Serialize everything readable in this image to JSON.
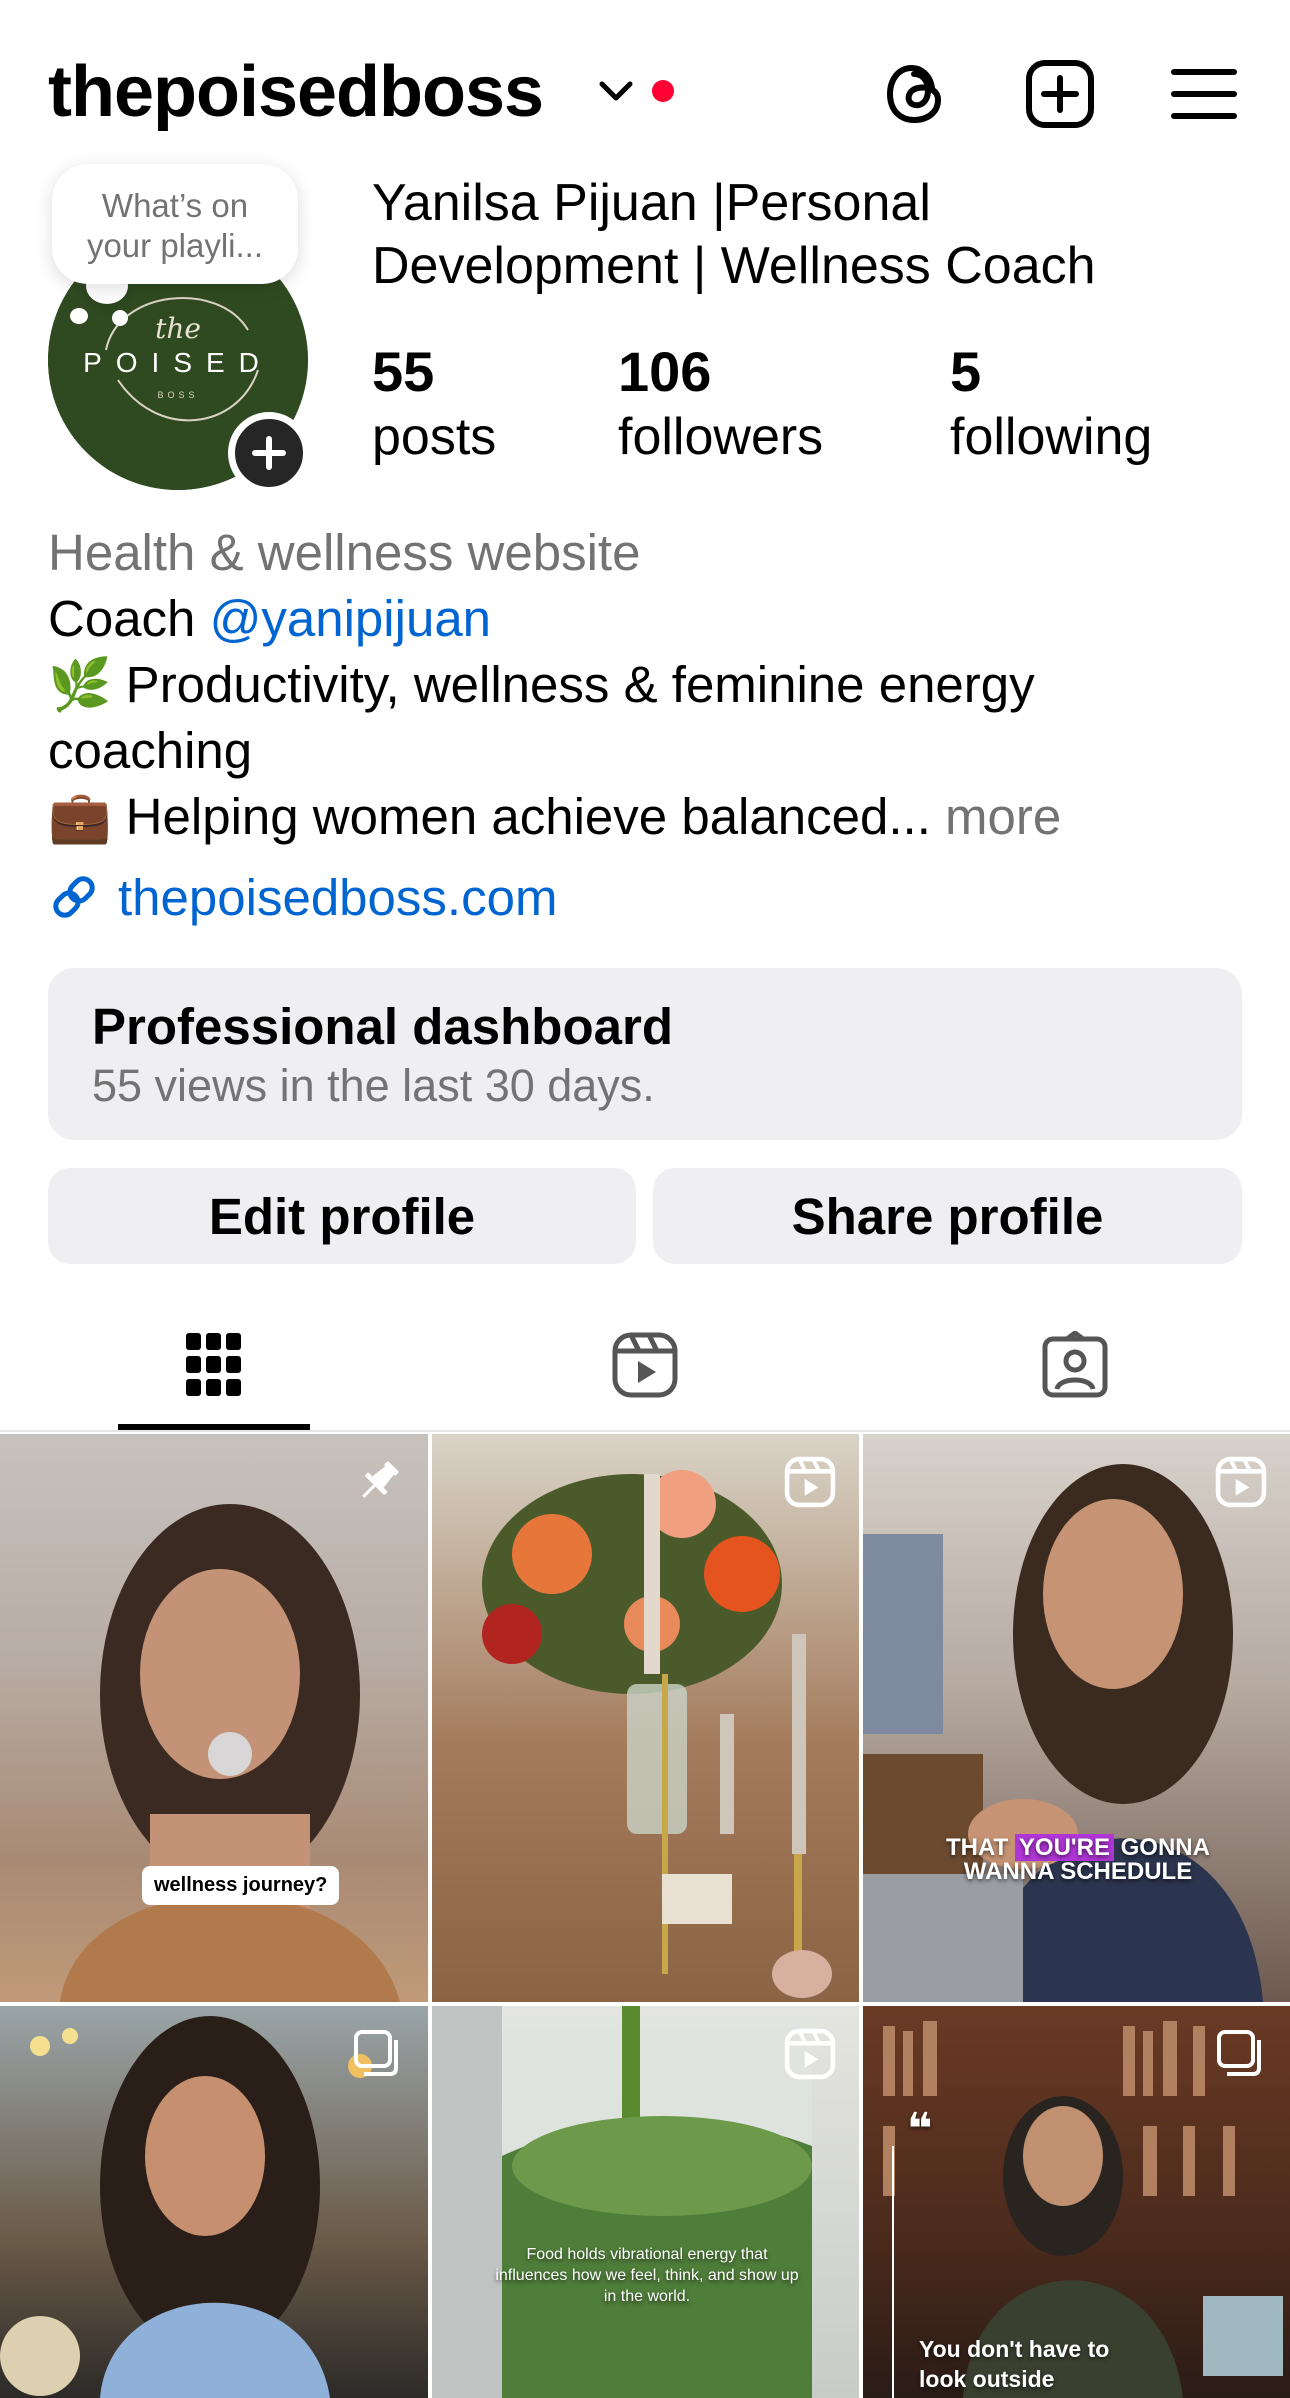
{
  "header": {
    "username": "thepoisedboss"
  },
  "bubble": {
    "line1": "What’s on",
    "line2": "your playli..."
  },
  "profile": {
    "full_name_line1": "Yanilsa Pijuan |Personal",
    "full_name_line2": "Development | Wellness Coach",
    "stats": [
      {
        "value": "55",
        "label": "posts"
      },
      {
        "value": "106",
        "label": "followers"
      },
      {
        "value": "5",
        "label": "following"
      }
    ]
  },
  "bio": {
    "category": "Health & wellness website",
    "coach_prefix": "Coach ",
    "mention": "@yanipijuan",
    "line3_emoji": "🌿",
    "line3": " Productivity, wellness & feminine energy",
    "line4": "coaching",
    "line5_emoji": "💼",
    "line5": " Helping women achieve balanced",
    "ellipsis": "...",
    "more": " more",
    "link": "thepoisedboss.com"
  },
  "dashboard": {
    "title": "Professional dashboard",
    "subtitle": "55 views in the last 30 days."
  },
  "buttons": {
    "edit": "Edit profile",
    "share": "Share profile"
  },
  "grid": {
    "post1_caption": "wellness journey?",
    "post3_caption_a": "THAT",
    "post3_caption_b": "YOU'RE",
    "post3_caption_c": "GONNA",
    "post3_caption_line2": "WANNA SCHEDULE",
    "post5_caption_l1": "Food holds vibrational energy that",
    "post5_caption_l2": "influences how we feel, think, and show up",
    "post5_caption_l3": "in the world.",
    "post6_caption_l1": "You don't have to",
    "post6_caption_l2": "look outside"
  },
  "colors": {
    "accent_blue": "#0064d1",
    "notification_red": "#ff0033",
    "button_bg": "#efeff2",
    "secondary_text": "#737373"
  }
}
